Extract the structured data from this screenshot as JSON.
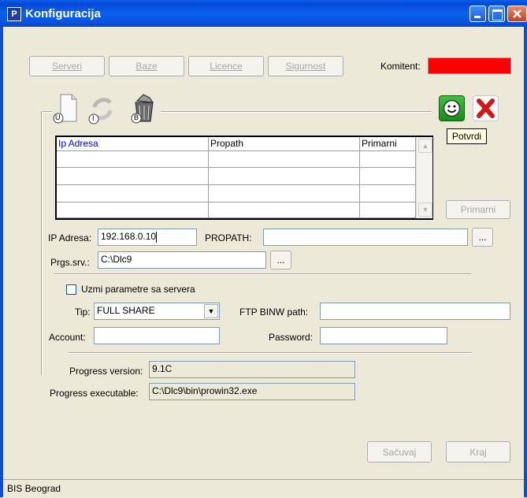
{
  "window": {
    "title": "Konfiguracija",
    "icon_glyph": "P"
  },
  "tabs": {
    "serveri": "Serveri",
    "baze": "Baze",
    "licence": "Licence",
    "sigurnost": "Sigurnost"
  },
  "komitent": {
    "label": "Komitent:",
    "color": "#ff0000"
  },
  "toolbar": {
    "icon_u": "U",
    "icon_i": "I",
    "icon_b": "B",
    "tooltip": "Potvrdi"
  },
  "grid": {
    "columns": [
      "Ip Adresa",
      "Propath",
      "Primarni"
    ],
    "rows": 4
  },
  "primarni_button": "Primarni",
  "ip": {
    "label": "IP Adresa:",
    "value": "192.168.0.10"
  },
  "propath": {
    "label": "PROPATH:",
    "value": "",
    "browse": "..."
  },
  "prgs": {
    "label": "Prgs.srv.:",
    "value": "C:\\Dlc9",
    "browse": "..."
  },
  "uzmi": {
    "label": "Uzmi parametre sa servera",
    "checked": false
  },
  "tip": {
    "label": "Tip:",
    "value": "FULL SHARE"
  },
  "ftp": {
    "label": "FTP BINW path:",
    "value": ""
  },
  "account": {
    "label": "Account:",
    "value": ""
  },
  "password": {
    "label": "Password:",
    "value": ""
  },
  "progress_version": {
    "label": "Progress version:",
    "value": "9.1C"
  },
  "progress_exe": {
    "label": "Progress executable:",
    "value": "C:\\Dlc9\\bin\\prowin32.exe"
  },
  "buttons": {
    "sacuvaj": "Sačuvaj",
    "kraj": "Kraj"
  },
  "status": "BIS Beograd"
}
